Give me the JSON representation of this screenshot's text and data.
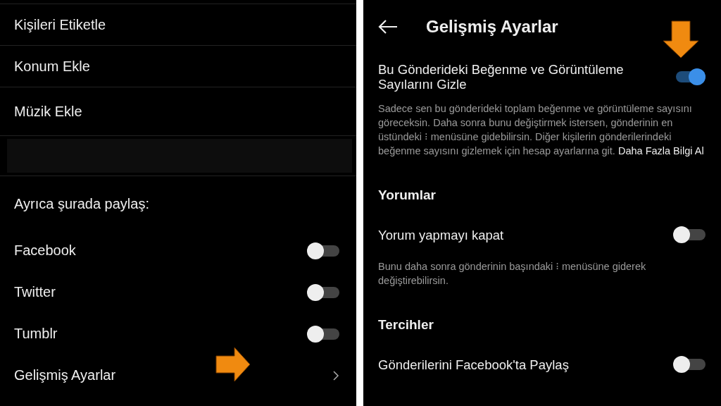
{
  "left_panel": {
    "menu_items": [
      {
        "label": "Kişileri Etiketle"
      },
      {
        "label": "Konum Ekle"
      },
      {
        "label": "Müzik Ekle"
      }
    ],
    "share_heading": "Ayrıca şurada paylaş:",
    "share_options": [
      {
        "label": "Facebook",
        "on": false
      },
      {
        "label": "Twitter",
        "on": false
      },
      {
        "label": "Tumblr",
        "on": false
      }
    ],
    "advanced_item": {
      "label": "Gelişmiş Ayarlar"
    }
  },
  "right_panel": {
    "title": "Gelişmiş Ayarlar",
    "sections": [
      {
        "kind": "toggle",
        "label": "Bu Gönderideki Beğenme ve Görüntüleme Sayılarını Gizle",
        "on": true,
        "description": "Sadece sen bu gönderideki toplam beğenme ve görüntüleme sayısını göreceksin. Daha sonra bunu değiştirmek istersen, gönderinin en üstündeki ⁝ menüsüne gidebilirsin. Diğer kişilerin gönderilerindeki beğenme sayısını gizlemek için hesap ayarlarına git.",
        "link": "Daha Fazla Bilgi Al"
      },
      {
        "kind": "heading",
        "label": "Yorumlar"
      },
      {
        "kind": "toggle",
        "label": "Yorum yapmayı kapat",
        "on": false,
        "description": "Bunu daha sonra gönderinin başındaki ⁝ menüsüne giderek değiştirebilirsin."
      },
      {
        "kind": "heading",
        "label": "Tercihler"
      },
      {
        "kind": "toggle",
        "label": "Gönderilerini Facebook'ta Paylaş",
        "on": false
      }
    ]
  }
}
